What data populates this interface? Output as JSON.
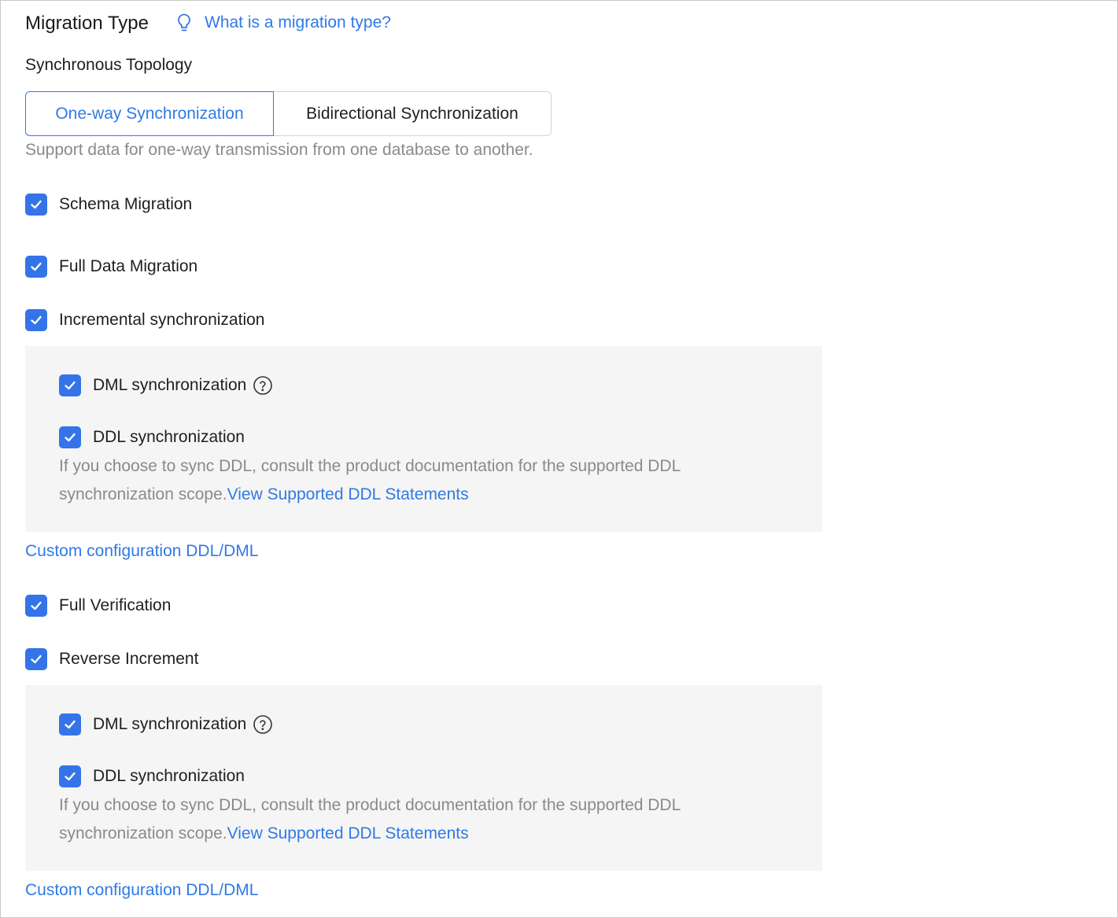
{
  "header": {
    "title": "Migration Type",
    "help_link": "What is a migration type?"
  },
  "topology": {
    "label": "Synchronous Topology",
    "options": [
      "One-way Synchronization",
      "Bidirectional Synchronization"
    ],
    "selected": "One-way Synchronization",
    "description": "Support data for one-way transmission from one database to another."
  },
  "options": {
    "schema_migration": {
      "label": "Schema Migration",
      "checked": true
    },
    "full_data_migration": {
      "label": "Full Data Migration",
      "checked": true
    },
    "incremental_sync": {
      "label": "Incremental synchronization",
      "checked": true,
      "dml": {
        "label": "DML synchronization",
        "checked": true
      },
      "ddl": {
        "label": "DDL synchronization",
        "checked": true
      },
      "hint_text": "If you choose to sync DDL, consult the product documentation for the supported DDL synchronization scope.",
      "hint_link": "View Supported DDL Statements",
      "custom_link": "Custom configuration DDL/DML"
    },
    "full_verification": {
      "label": "Full Verification",
      "checked": true
    },
    "reverse_increment": {
      "label": "Reverse Increment",
      "checked": true,
      "dml": {
        "label": "DML synchronization",
        "checked": true
      },
      "ddl": {
        "label": "DDL synchronization",
        "checked": true
      },
      "hint_text": "If you choose to sync DDL, consult the product documentation for the supported DDL synchronization scope.",
      "hint_link": "View Supported DDL Statements",
      "custom_link": "Custom configuration DDL/DML"
    }
  },
  "icons": {
    "bulb": "lightbulb-icon",
    "question": "question-circle-icon",
    "check": "checkmark-icon"
  },
  "colors": {
    "accent": "#2f7ae5",
    "checkbox": "#3574e8",
    "muted_text": "#8a8a8a",
    "panel_bg": "#f5f5f5"
  }
}
